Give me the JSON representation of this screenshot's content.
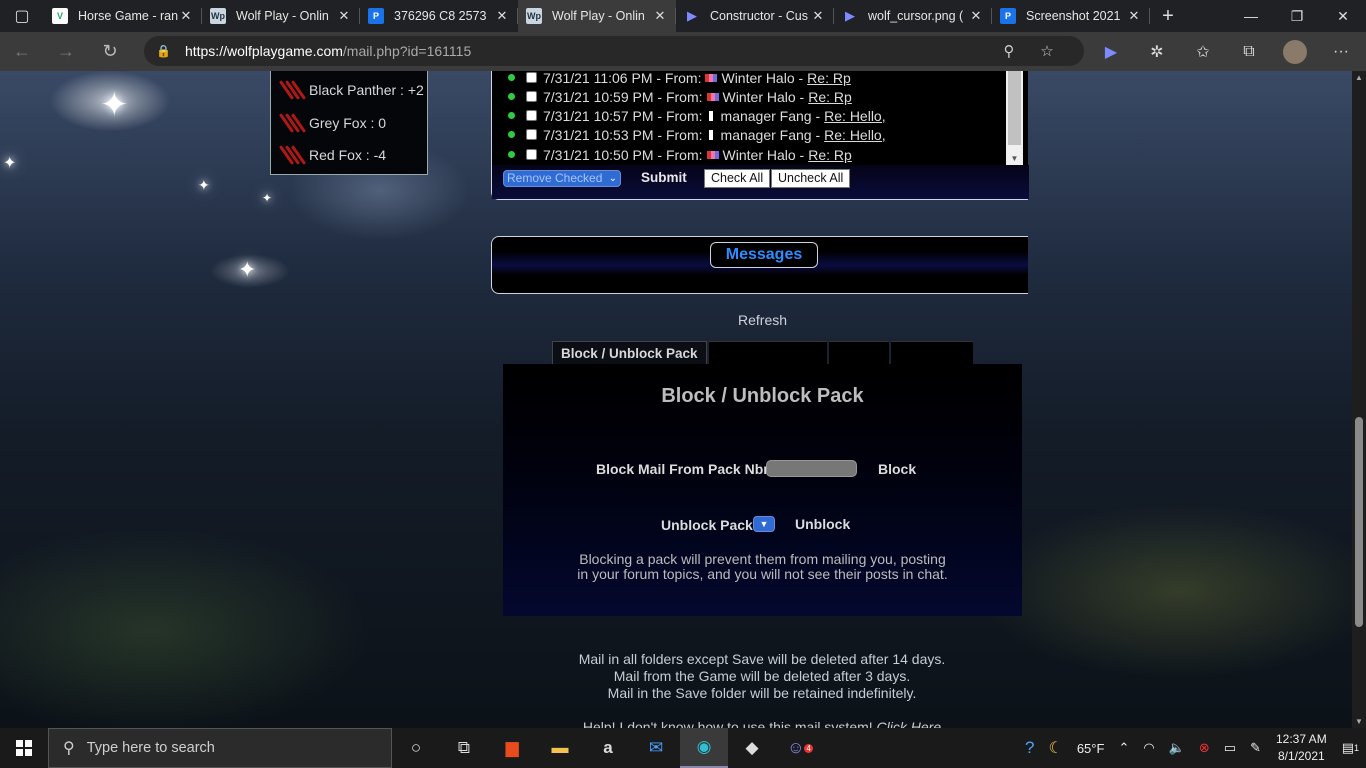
{
  "browser": {
    "tabs": [
      {
        "title": "Horse Game - ran",
        "favicon_text": "",
        "favicon_color": "#ffffff"
      },
      {
        "title": "Wolf Play - Onlin",
        "favicon_text": "Wp",
        "favicon_color": "#c9d6e0"
      },
      {
        "title": "376296 C8 2573",
        "favicon_text": "P",
        "favicon_color": "#1a73e8"
      },
      {
        "title": "Wolf Play - Onlin",
        "favicon_text": "Wp",
        "favicon_color": "#c9d6e0"
      },
      {
        "title": "Constructor - Cus",
        "favicon_text": "",
        "favicon_color": "#202124"
      },
      {
        "title": "wolf_cursor.png (",
        "favicon_text": "",
        "favicon_color": "#202124"
      },
      {
        "title": "Screenshot 2021",
        "favicon_text": "P",
        "favicon_color": "#1a73e8"
      }
    ],
    "active_tab_index": 3,
    "url_host": "https://wolfplaygame.com",
    "url_path": "/mail.php?id=161115"
  },
  "pack_panel": {
    "rows": [
      {
        "label": "Black Panther : +2"
      },
      {
        "label": "Grey Fox : 0"
      },
      {
        "label": "Red Fox : -4"
      }
    ]
  },
  "mail": {
    "rows": [
      {
        "date": "7/31/21 11:06 PM - From:",
        "sender": "Winter Halo -",
        "subject": "Re: Rp",
        "flag": "color"
      },
      {
        "date": "7/31/21 10:59 PM - From:",
        "sender": "Winter Halo -",
        "subject": "Re: Rp",
        "flag": "color"
      },
      {
        "date": "7/31/21 10:57 PM - From:",
        "sender": "manager Fang -",
        "subject": "Re: Hello,",
        "flag": "white"
      },
      {
        "date": "7/31/21 10:53 PM - From:",
        "sender": "manager Fang -",
        "subject": "Re: Hello,",
        "flag": "white"
      },
      {
        "date": "7/31/21 10:50 PM - From:",
        "sender": "Winter Halo -",
        "subject": "Re: Rp",
        "flag": "color"
      }
    ],
    "remove_select_value": "Remove Checked",
    "submit_label": "Submit",
    "check_all_label": "Check All",
    "uncheck_all_label": "Uncheck All"
  },
  "messages_title": "Messages",
  "refresh_label": "Refresh",
  "block_section": {
    "tabs": [
      {
        "label": "Block / Unblock Pack"
      },
      {
        "label": ""
      },
      {
        "label": ""
      },
      {
        "label": ""
      }
    ],
    "title": "Block / Unblock Pack",
    "block_label": "Block Mail From Pack Nbr",
    "block_input_value": "",
    "block_button": "Block",
    "unblock_label": "Unblock Pack",
    "unblock_button": "Unblock",
    "note": "Blocking a pack will prevent them from mailing you, posting in your forum topics, and you will not see their posts in chat."
  },
  "footer": {
    "lines": [
      "Mail in all folders except Save will be deleted after 14 days.",
      "Mail from the Game will be deleted after 3 days.",
      "Mail in the Save folder will be retained indefinitely."
    ],
    "help_text": "Help! I don't know how to use this mail system!",
    "help_link": "Click Here"
  },
  "taskbar": {
    "search_placeholder": "Type here to search",
    "temperature": "65°F",
    "time": "12:37 AM",
    "date": "8/1/2021",
    "notification_count": "1",
    "discord_badge": "4"
  },
  "colors": {
    "accent_link": "#2d8cff",
    "online_dot": "#2ecc40",
    "select_blue": "#2e6bd3"
  }
}
